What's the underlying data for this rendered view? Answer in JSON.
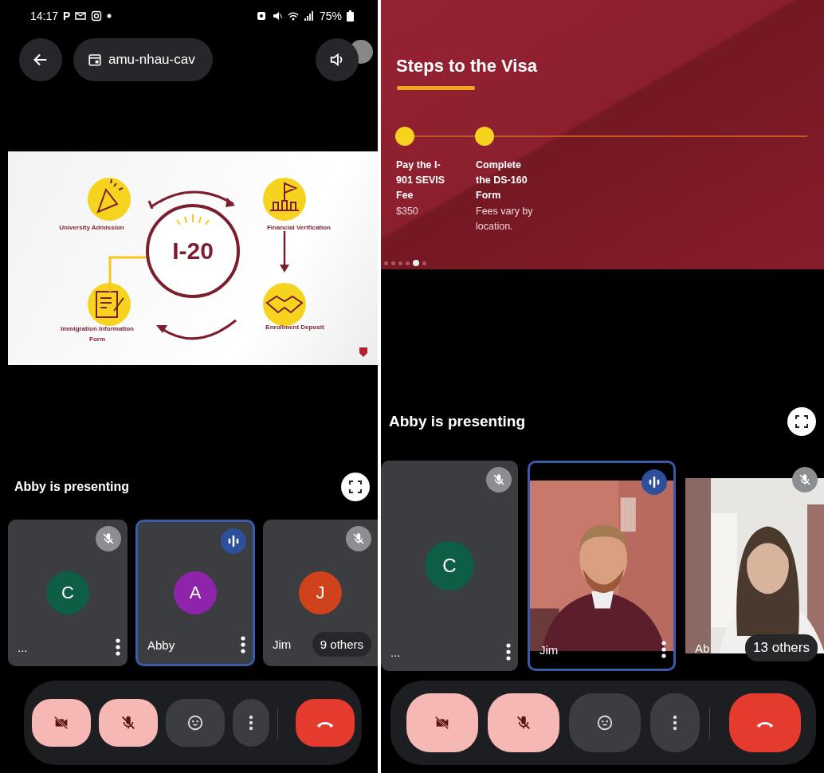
{
  "panels": [
    {
      "status_bar": {
        "time": "14:17",
        "app_letter": "P",
        "battery": "75%"
      },
      "top_bar": {
        "meeting_code": "amu-nhau-cav"
      },
      "slide": {
        "kind": "cycle",
        "center": "I-20",
        "stages": [
          {
            "label": "University Admission"
          },
          {
            "label": "Financial Verification"
          },
          {
            "label": "Immigration Information Form"
          },
          {
            "label": "Enrollment Deposit"
          }
        ]
      },
      "presenting": "Abby is presenting",
      "tiles": [
        {
          "kind": "avatar",
          "name": "...",
          "initial": "C",
          "color": "#0d5e44",
          "speaking": false
        },
        {
          "kind": "avatar",
          "name": "Abby",
          "initial": "A",
          "color": "#8e24aa",
          "speaking": true
        },
        {
          "kind": "avatar",
          "name": "Jim",
          "initial": "J",
          "color": "#d0421b",
          "speaking": false,
          "others": "9 others"
        }
      ],
      "controls": {
        "camera_on": false,
        "mic_on": false
      }
    },
    {
      "slide": {
        "kind": "steps",
        "title": "Steps to the Visa",
        "steps": [
          {
            "heading": "Pay the I-901 SEVIS Fee",
            "note": "$350"
          },
          {
            "heading": "Complete the DS-160 Form",
            "note": "Fees vary by location."
          }
        ]
      },
      "presenting": "Abby is presenting",
      "tiles": [
        {
          "kind": "avatar",
          "name": "...",
          "initial": "C",
          "color": "#0d5e44",
          "speaking": false
        },
        {
          "kind": "video",
          "name": "Jim",
          "speaking": true
        },
        {
          "kind": "video",
          "name": "Ab",
          "speaking": false,
          "others": "13 others"
        }
      ],
      "controls": {
        "camera_on": false,
        "mic_on": false
      }
    }
  ]
}
